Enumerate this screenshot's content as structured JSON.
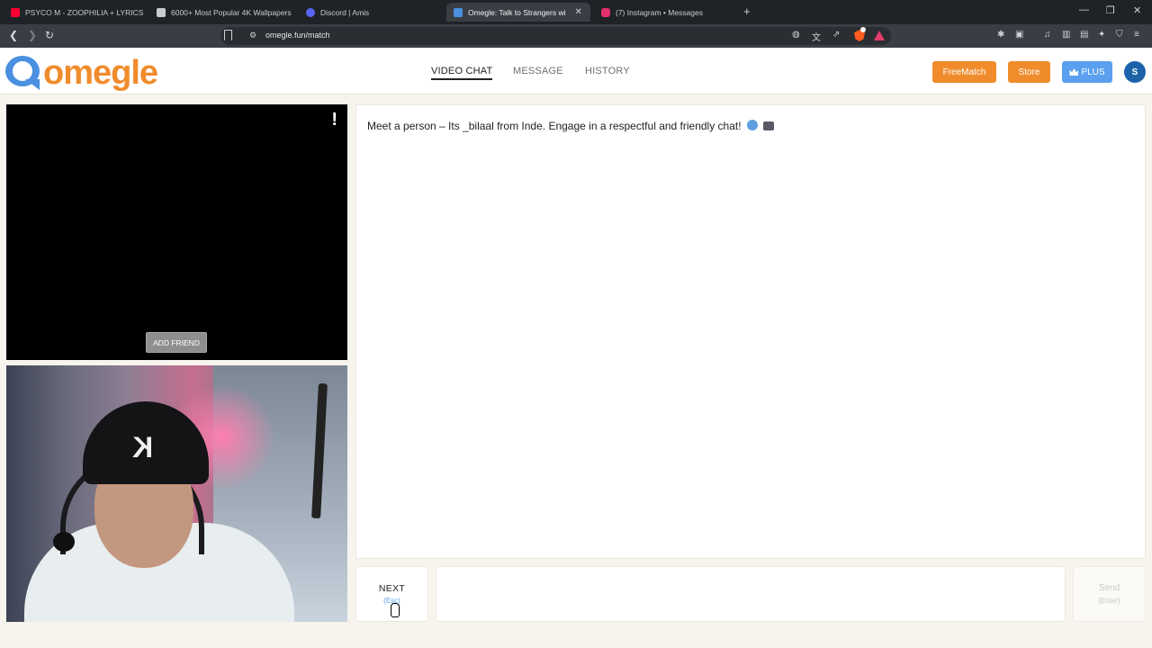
{
  "browser": {
    "tabs": [
      {
        "title": "PSYCO M - ZOOPHILIA + LYRICS (TN",
        "favicon": "youtube-icon",
        "color": "#ff0033"
      },
      {
        "title": "6000+ Most Popular 4K Wallpapers",
        "favicon": "wallpaper-site-icon",
        "color": "#c9ccd1"
      },
      {
        "title": "Discord | Amis",
        "favicon": "discord-icon",
        "color": "#5865f2"
      },
      {
        "title": "Omegle: Talk to Strangers wi",
        "favicon": "omegle-icon",
        "color": "#4a8fe0",
        "active": true
      },
      {
        "title": "(7) Instagram • Messages",
        "favicon": "instagram-icon",
        "color": "#e1306c"
      }
    ],
    "url": "omegle.fun/match"
  },
  "site": {
    "logo_text": "omegle",
    "nav": {
      "video_chat": "VIDEO CHAT",
      "message": "MESSAGE",
      "history": "HISTORY"
    },
    "buttons": {
      "freematch": "FreeMatch",
      "store": "Store",
      "plus": "PLUS"
    },
    "avatar_initial": "S",
    "colors": {
      "brand_orange": "#f08c2c",
      "brand_blue": "#4a8fe0",
      "plus_blue": "#5aa0ef"
    }
  },
  "video": {
    "report_symbol": "!",
    "add_friend": "ADD FRIEND"
  },
  "chat": {
    "message": "Meet a person – Its _bilaal from Inde. Engage in a respectful and friendly chat!"
  },
  "controls": {
    "next_label": "NEXT",
    "next_hint": "(Esc)",
    "send_label": "Send",
    "send_hint": "(Enter)"
  }
}
